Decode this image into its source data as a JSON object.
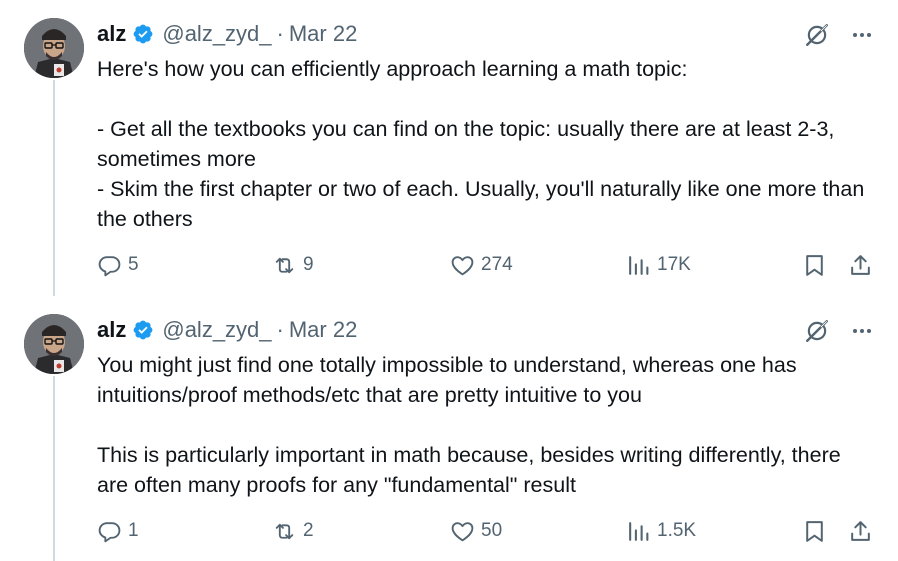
{
  "tweets": [
    {
      "author": {
        "name": "alz",
        "handle": "@alz_zyd_",
        "verified": true,
        "avatar_icon": "avatar-icon"
      },
      "separator": "·",
      "date": "Mar 22",
      "paragraphs": [
        "Here's how you can efficiently approach learning a math topic:",
        "",
        "- Get all the textbooks you can find on the topic: usually there are at least 2-3, sometimes more",
        "- Skim the first chapter or two of each. Usually, you'll naturally like one more than the others"
      ],
      "actions": {
        "replies": "5",
        "reposts": "9",
        "likes": "274",
        "views": "17K"
      }
    },
    {
      "author": {
        "name": "alz",
        "handle": "@alz_zyd_",
        "verified": true,
        "avatar_icon": "avatar-icon"
      },
      "separator": "·",
      "date": "Mar 22",
      "paragraphs": [
        "You might just find one totally impossible to understand, whereas one has intuitions/proof methods/etc that are pretty intuitive to you",
        "",
        "This is particularly important in math because, besides writing differently, there are often many proofs for any \"fundamental\" result"
      ],
      "actions": {
        "replies": "1",
        "reposts": "2",
        "likes": "50",
        "views": "1.5K"
      }
    }
  ],
  "colors": {
    "text": "#0f1419",
    "muted": "#536471",
    "verified": "#1d9bf0",
    "thread_line": "#cfd9de"
  }
}
